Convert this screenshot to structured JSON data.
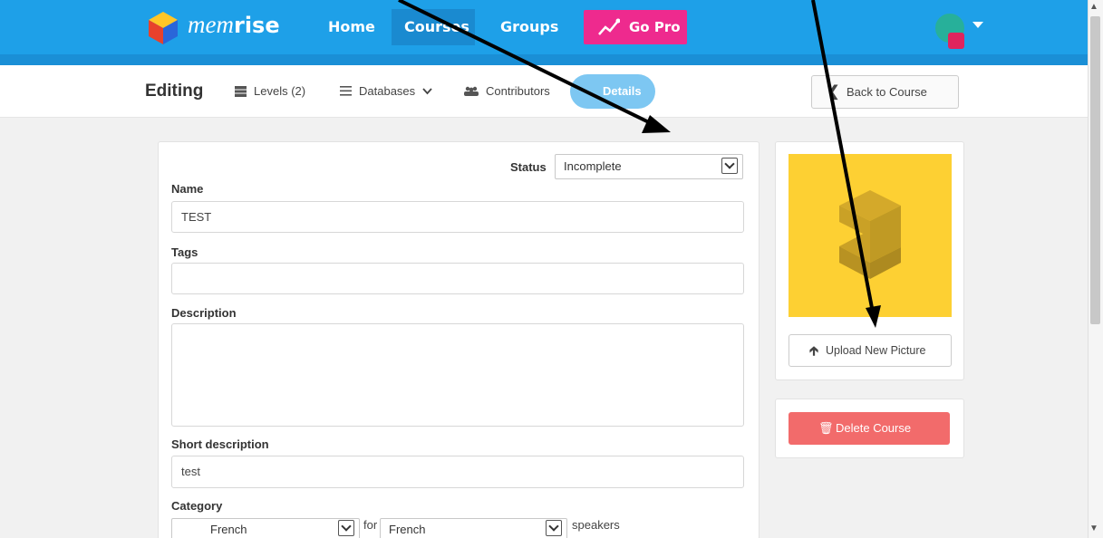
{
  "nav": {
    "logo_prefix": "mem",
    "logo_suffix": "rise",
    "home": "Home",
    "courses": "Courses",
    "groups": "Groups",
    "go_pro": "Go Pro"
  },
  "subnav": {
    "editing": "Editing",
    "levels": "Levels (2)",
    "databases": "Databases",
    "contributors": "Contributors",
    "details": "Details",
    "back": "Back to Course"
  },
  "form": {
    "status_label": "Status",
    "status_value": "Incomplete",
    "name_label": "Name",
    "name_value": "TEST",
    "tags_label": "Tags",
    "tags_value": "",
    "description_label": "Description",
    "description_value": "",
    "short_description_label": "Short description",
    "short_description_value": "test",
    "category_label": "Category",
    "category_value": "French",
    "for_text": "for",
    "speakers_language": "French",
    "speakers_text": "speakers"
  },
  "sidebar": {
    "upload_label": "Upload New Picture",
    "delete_label": "Delete Course"
  },
  "colors": {
    "topbar": "#1ea0e8",
    "go_pro": "#ee2a8e",
    "details_pill": "#7dc7f2",
    "course_image": "#fdd033",
    "delete_button": "#f26b6b"
  }
}
